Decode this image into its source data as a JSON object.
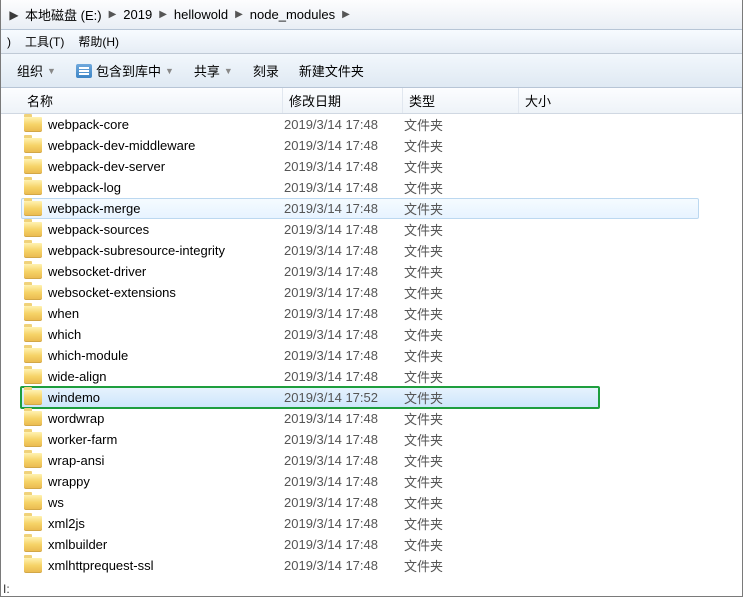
{
  "breadcrumb": [
    {
      "label": "本地磁盘 (E:)"
    },
    {
      "label": "2019"
    },
    {
      "label": "hellowold"
    },
    {
      "label": "node_modules"
    }
  ],
  "menu": {
    "partial": ")",
    "tools": "工具(T)",
    "help": "帮助(H)"
  },
  "toolbar": {
    "organize": "组织",
    "include": "包含到库中",
    "share": "共享",
    "burn": "刻录",
    "newfolder": "新建文件夹"
  },
  "columns": {
    "name": "名称",
    "date": "修改日期",
    "type": "类型",
    "size": "大小"
  },
  "type_folder": "文件夹",
  "side_label": "I:",
  "items": [
    {
      "name": "webpack-core",
      "date": "2019/3/14 17:48"
    },
    {
      "name": "webpack-dev-middleware",
      "date": "2019/3/14 17:48"
    },
    {
      "name": "webpack-dev-server",
      "date": "2019/3/14 17:48"
    },
    {
      "name": "webpack-log",
      "date": "2019/3/14 17:48"
    },
    {
      "name": "webpack-merge",
      "date": "2019/3/14 17:48",
      "hovered": true
    },
    {
      "name": "webpack-sources",
      "date": "2019/3/14 17:48"
    },
    {
      "name": "webpack-subresource-integrity",
      "date": "2019/3/14 17:48"
    },
    {
      "name": "websocket-driver",
      "date": "2019/3/14 17:48"
    },
    {
      "name": "websocket-extensions",
      "date": "2019/3/14 17:48"
    },
    {
      "name": "when",
      "date": "2019/3/14 17:48"
    },
    {
      "name": "which",
      "date": "2019/3/14 17:48"
    },
    {
      "name": "which-module",
      "date": "2019/3/14 17:48"
    },
    {
      "name": "wide-align",
      "date": "2019/3/14 17:48"
    },
    {
      "name": "windemo",
      "date": "2019/3/14 17:52",
      "selected": true,
      "boxed": true
    },
    {
      "name": "wordwrap",
      "date": "2019/3/14 17:48"
    },
    {
      "name": "worker-farm",
      "date": "2019/3/14 17:48"
    },
    {
      "name": "wrap-ansi",
      "date": "2019/3/14 17:48"
    },
    {
      "name": "wrappy",
      "date": "2019/3/14 17:48"
    },
    {
      "name": "ws",
      "date": "2019/3/14 17:48"
    },
    {
      "name": "xml2js",
      "date": "2019/3/14 17:48"
    },
    {
      "name": "xmlbuilder",
      "date": "2019/3/14 17:48"
    },
    {
      "name": "xmlhttprequest-ssl",
      "date": "2019/3/14 17:48"
    }
  ]
}
